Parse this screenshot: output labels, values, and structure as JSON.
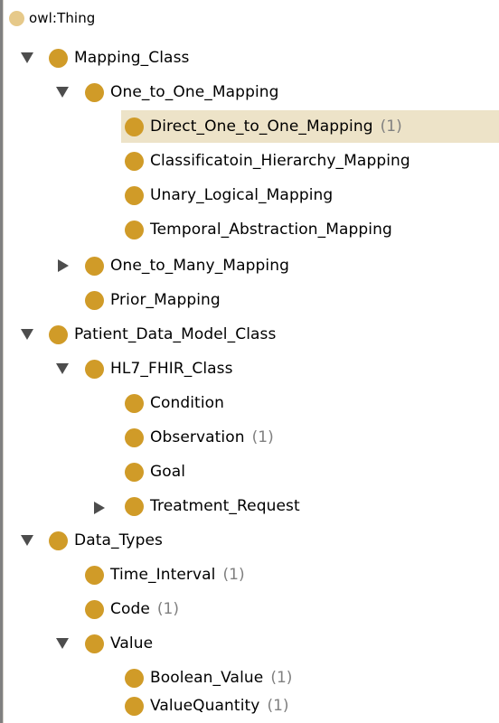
{
  "tree": {
    "root": {
      "label": "owl:Thing"
    },
    "nodes": [
      {
        "label": "Mapping_Class",
        "count": "",
        "state": "expanded"
      },
      {
        "label": "One_to_One_Mapping",
        "count": "",
        "state": "expanded"
      },
      {
        "label": "Direct_One_to_One_Mapping",
        "count": "(1)",
        "state": "leaf",
        "selected": true
      },
      {
        "label": "Classificatoin_Hierarchy_Mapping",
        "count": "",
        "state": "leaf"
      },
      {
        "label": "Unary_Logical_Mapping",
        "count": "",
        "state": "leaf"
      },
      {
        "label": "Temporal_Abstraction_Mapping",
        "count": "",
        "state": "leaf"
      },
      {
        "label": "One_to_Many_Mapping",
        "count": "",
        "state": "collapsed"
      },
      {
        "label": "Prior_Mapping",
        "count": "",
        "state": "leaf"
      },
      {
        "label": "Patient_Data_Model_Class",
        "count": "",
        "state": "expanded"
      },
      {
        "label": "HL7_FHIR_Class",
        "count": "",
        "state": "expanded"
      },
      {
        "label": "Condition",
        "count": "",
        "state": "leaf"
      },
      {
        "label": "Observation",
        "count": "(1)",
        "state": "leaf"
      },
      {
        "label": "Goal",
        "count": "",
        "state": "leaf"
      },
      {
        "label": "Treatment_Request",
        "count": "",
        "state": "collapsed"
      },
      {
        "label": "Data_Types",
        "count": "",
        "state": "expanded"
      },
      {
        "label": "Time_Interval",
        "count": "(1)",
        "state": "leaf"
      },
      {
        "label": "Code",
        "count": "(1)",
        "state": "leaf"
      },
      {
        "label": "Value",
        "count": "",
        "state": "expanded"
      },
      {
        "label": "Boolean_Value",
        "count": "(1)",
        "state": "leaf"
      },
      {
        "label": "ValueQuantity",
        "count": "(1)",
        "state": "leaf"
      }
    ]
  },
  "colors": {
    "class_icon": "#d09b28",
    "root_icon": "#e6c98a",
    "selection": "#ede3c8",
    "count_text": "#808080",
    "toggle": "#4d4d4d"
  },
  "icons": {
    "class": "class-circle-icon",
    "root": "thing-circle-icon",
    "expanded": "triangle-down-icon",
    "collapsed": "triangle-right-icon"
  }
}
